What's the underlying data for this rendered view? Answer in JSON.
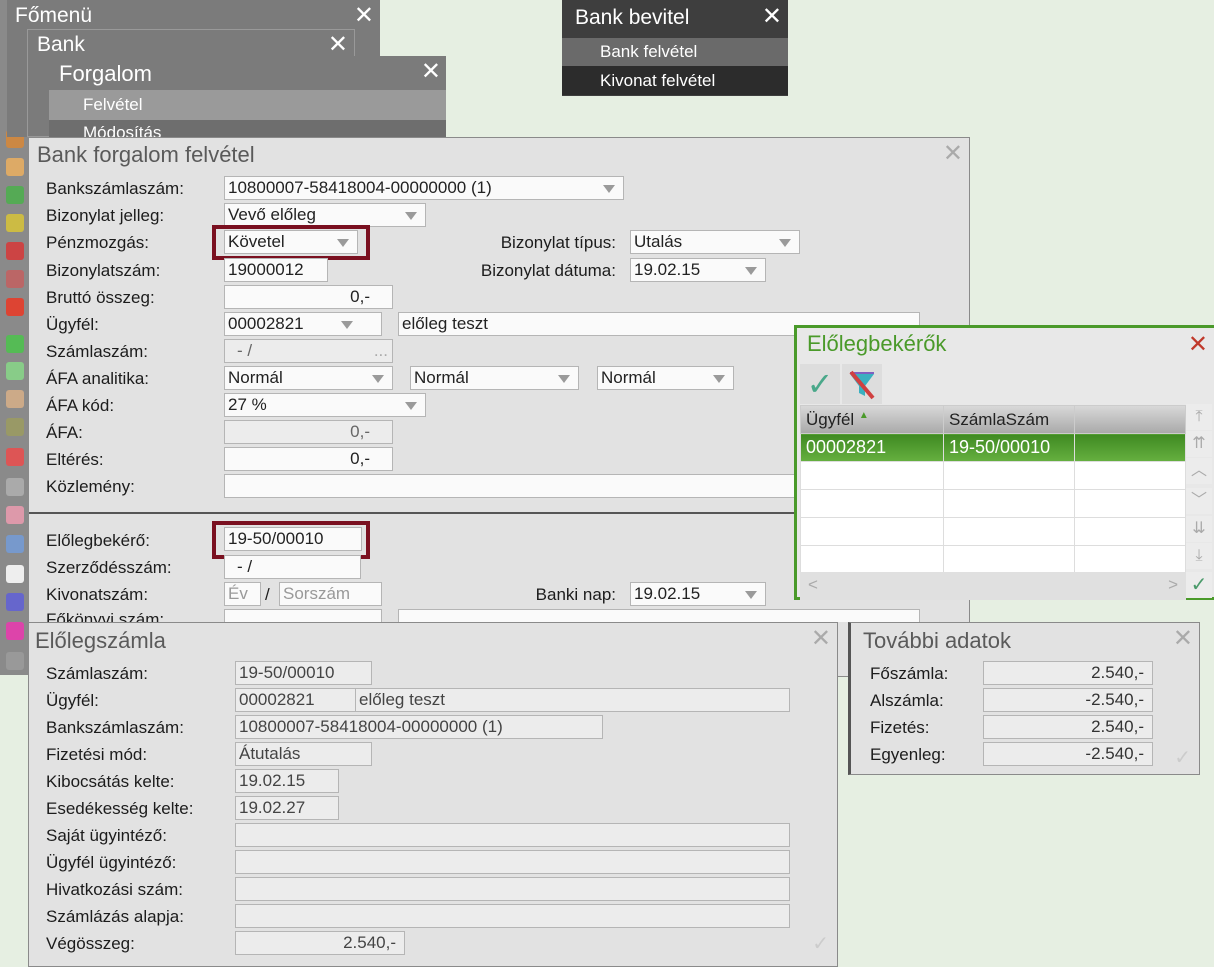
{
  "menus": {
    "fomenu": "Főmenü",
    "bank": "Bank",
    "forgalom": "Forgalom",
    "forgalom_items": [
      "Felvétel",
      "Módosítás"
    ]
  },
  "bank_bevitel": {
    "title": "Bank bevitel",
    "items": [
      "Bank felvétel",
      "Kivonat felvétel"
    ]
  },
  "main": {
    "title": "Bank forgalom felvétel",
    "labels": {
      "bankszamla": "Bankszámlaszám:",
      "jelleg": "Bizonylat jelleg:",
      "penzmozgas": "Pénzmozgás:",
      "tipus": "Bizonylat típus:",
      "bizszam": "Bizonylatszám:",
      "datum": "Bizonylat dátuma:",
      "brutto": "Bruttó összeg:",
      "ugyfel": "Ügyfél:",
      "szamlaszam": "Számlaszám:",
      "afa_an": "ÁFA analitika:",
      "afa_kod": "ÁFA kód:",
      "afa": "ÁFA:",
      "elteres": "Eltérés:",
      "kozlemeny": "Közlemény:",
      "elolegbekero": "Előlegbekérő:",
      "szerzodes": "Szerződésszám:",
      "kivonat": "Kivonatszám:",
      "banki_nap": "Banki nap:",
      "fokonyv": "Főkönyvi szám:"
    },
    "values": {
      "bankszamla": "10800007-58418004-00000000 (1)",
      "jelleg": "Vevő előleg",
      "penzmozgas": "Követel",
      "tipus": "Utalás",
      "bizszam": "19000012",
      "datum": "19.02.15",
      "brutto": "0,-",
      "ugyfel_kod": "00002821",
      "ugyfel_nev": "előleg teszt",
      "szamlaszam": "- /",
      "szamlaszam_more": "...",
      "afa_an1": "Normál",
      "afa_an2": "Normál",
      "afa_an3": "Normál",
      "afa_kod": "27 %",
      "afa": "0,-",
      "elteres": "0,-",
      "kozlemeny": "",
      "elolegbekero": "19-50/00010",
      "szerzodes": "- /",
      "kivonat_slash": "/",
      "banki_nap": "19.02.15"
    },
    "placeholders": {
      "ev": "Év",
      "sorszam": "Sorszám"
    }
  },
  "popup": {
    "title": "Előlegbekérők",
    "columns": [
      "Ügyfél",
      "SzámlaSzám",
      ""
    ],
    "rows": [
      [
        "00002821",
        "19-50/00010",
        ""
      ],
      [
        "",
        "",
        ""
      ],
      [
        "",
        "",
        ""
      ],
      [
        "",
        "",
        ""
      ],
      [
        "",
        "",
        ""
      ]
    ]
  },
  "eloleg": {
    "title": "Előlegszámla",
    "fields": [
      {
        "label": "Számlaszám:",
        "value": "19-50/00010"
      },
      {
        "label": "Ügyfél:",
        "value": "00002821",
        "value2": "előleg teszt"
      },
      {
        "label": "Bankszámlaszám:",
        "value": "10800007-58418004-00000000 (1)"
      },
      {
        "label": "Fizetési mód:",
        "value": "Átutalás"
      },
      {
        "label": "Kibocsátás kelte:",
        "value": "19.02.15"
      },
      {
        "label": "Esedékesség kelte:",
        "value": "19.02.27"
      },
      {
        "label": "Saját ügyintéző:",
        "value": ""
      },
      {
        "label": "Ügyfél ügyintéző:",
        "value": ""
      },
      {
        "label": "Hivatkozási szám:",
        "value": ""
      },
      {
        "label": "Számlázás alapja:",
        "value": ""
      },
      {
        "label": "Végösszeg:",
        "value": "2.540,-"
      }
    ]
  },
  "tovabbi": {
    "title": "További adatok",
    "fields": [
      {
        "label": "Főszámla:",
        "value": "2.540,-"
      },
      {
        "label": "Alszámla:",
        "value": "-2.540,-"
      },
      {
        "label": "Fizetés:",
        "value": "2.540,-"
      },
      {
        "label": "Egyenleg:",
        "value": "-2.540,-"
      }
    ]
  },
  "colors": {
    "accent": "#4a9a2a",
    "highlight": "#7a1020"
  }
}
